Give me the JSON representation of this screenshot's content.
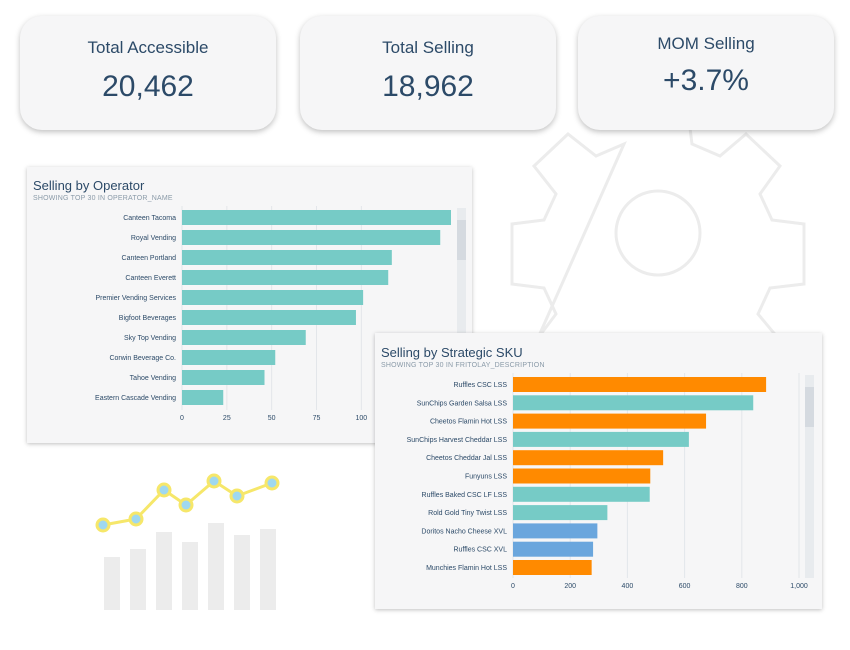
{
  "kpis": [
    {
      "title": "Total Accessible",
      "value": "20,462"
    },
    {
      "title": "Total Selling",
      "value": "18,962"
    },
    {
      "title": "MOM Selling",
      "value": "+3.7%"
    }
  ],
  "colors": {
    "teal": "#76cbc6",
    "orange": "#ff8a00",
    "blue": "#6aa6dd",
    "deco_yellow": "#f6e76a",
    "deco_dot": "#9fd8f0",
    "deco_bar": "#ececec"
  },
  "chart_data": [
    {
      "type": "bar",
      "orientation": "horizontal",
      "title": "Selling by Operator",
      "subtitle": "SHOWING TOP 30 IN OPERATOR_NAME",
      "categories": [
        "Canteen Tacoma",
        "Royal Vending",
        "Canteen Portland",
        "Canteen Everett",
        "Premier Vending Services",
        "Bigfoot Beverages",
        "Sky Top Vending",
        "Corwin Beverage Co.",
        "Tahoe Vending",
        "Eastern Cascade Vending"
      ],
      "values": [
        150,
        144,
        117,
        115,
        101,
        97,
        69,
        52,
        46,
        23
      ],
      "colors": [
        "#76cbc6",
        "#76cbc6",
        "#76cbc6",
        "#76cbc6",
        "#76cbc6",
        "#76cbc6",
        "#76cbc6",
        "#76cbc6",
        "#76cbc6",
        "#76cbc6"
      ],
      "xticks": [
        "0",
        "25",
        "50",
        "75",
        "100"
      ],
      "xlim": [
        0,
        150
      ]
    },
    {
      "type": "bar",
      "orientation": "horizontal",
      "title": "Selling by Strategic SKU",
      "subtitle": "SHOWING TOP 30 IN FRITOLAY_DESCRIPTION",
      "categories": [
        "Ruffles CSC LSS",
        "SunChips Garden Salsa LSS",
        "Cheetos Flamin Hot LSS",
        "SunChips Harvest Cheddar LSS",
        "Cheetos Cheddar Jal LSS",
        "Funyuns LSS",
        "Ruffles Baked CSC LF LSS",
        "Rold Gold Tiny Twist LSS",
        "Doritos Nacho Cheese XVL",
        "Ruffles CSC XVL",
        "Munchies Flamin Hot LSS"
      ],
      "values": [
        885,
        840,
        675,
        615,
        525,
        480,
        478,
        330,
        295,
        280,
        275
      ],
      "colors": [
        "#ff8a00",
        "#76cbc6",
        "#ff8a00",
        "#76cbc6",
        "#ff8a00",
        "#ff8a00",
        "#76cbc6",
        "#76cbc6",
        "#6aa6dd",
        "#6aa6dd",
        "#ff8a00"
      ],
      "xticks": [
        "0",
        "200",
        "400",
        "600",
        "800",
        "1,000"
      ],
      "xlim": [
        0,
        1000
      ]
    }
  ]
}
